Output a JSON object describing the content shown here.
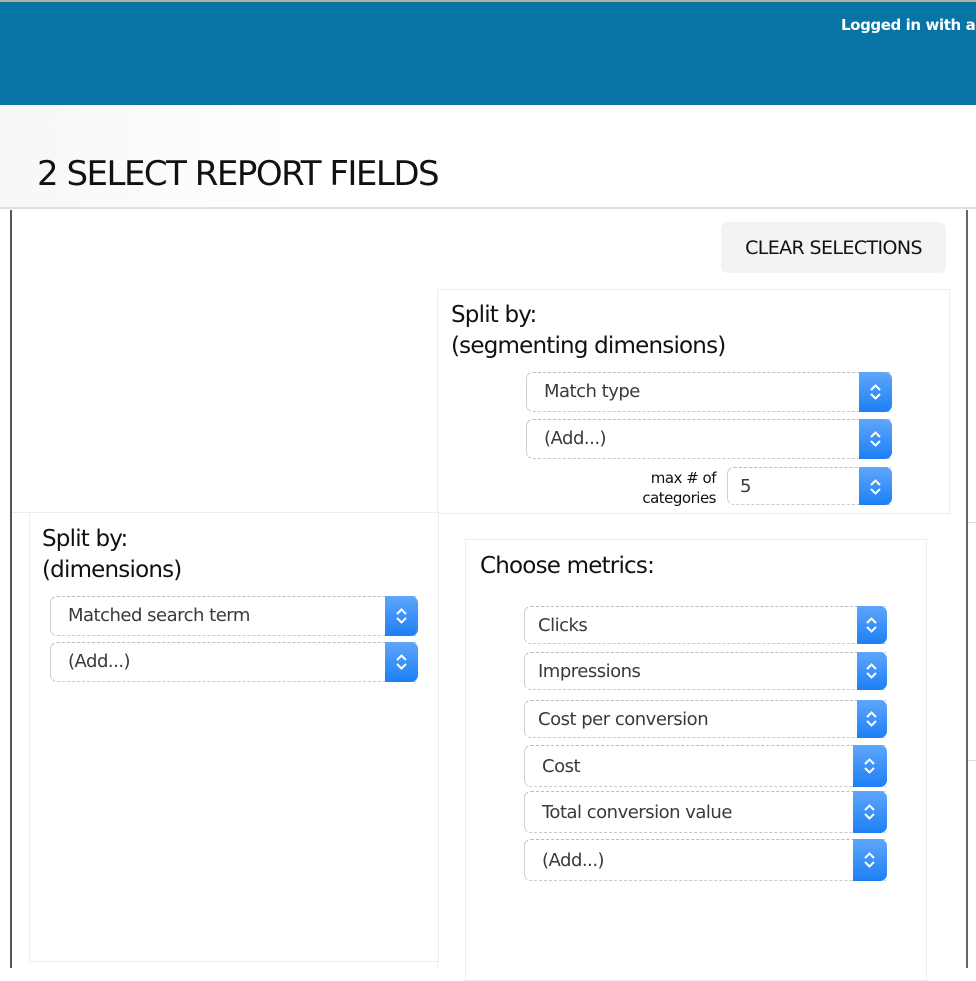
{
  "header": {
    "login_text": "Logged in with acc",
    "brand_color": "#0774a6"
  },
  "page": {
    "title": "2 SELECT REPORT FIELDS"
  },
  "toolbar": {
    "clear_label": "CLEAR SELECTIONS"
  },
  "segmenting": {
    "label_line1": "Split by:",
    "label_line2": "(segmenting dimensions)",
    "selects": [
      {
        "value": "Match type"
      },
      {
        "value": "(Add...)"
      }
    ],
    "max_label_line1": "max # of",
    "max_label_line2": "categories",
    "max_value": "5"
  },
  "dimensions": {
    "label_line1": "Split by:",
    "label_line2": "(dimensions)",
    "selects": [
      {
        "value": "Matched search term"
      },
      {
        "value": "(Add...)"
      }
    ]
  },
  "metrics": {
    "label": "Choose metrics:",
    "selects": [
      {
        "value": "Clicks"
      },
      {
        "value": "Impressions"
      },
      {
        "value": "Cost per conversion"
      },
      {
        "value": "Cost"
      },
      {
        "value": "Total conversion value"
      },
      {
        "value": "(Add...)"
      }
    ]
  },
  "icons": {
    "select_stepper": "chevron-up-down-icon",
    "select_accent": "#1d7ff5"
  }
}
